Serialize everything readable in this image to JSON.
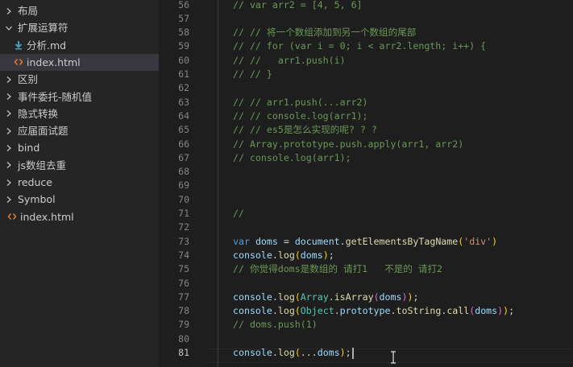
{
  "sidebar": {
    "items": [
      {
        "label": "布局",
        "type": "folder",
        "expanded": false
      },
      {
        "label": "扩展运算符",
        "type": "folder",
        "expanded": true
      },
      {
        "label": "分析.md",
        "type": "markdown",
        "icon": "markdown-download-icon"
      },
      {
        "label": "index.html",
        "type": "html",
        "selected": true
      },
      {
        "label": "区别",
        "type": "folder",
        "expanded": false
      },
      {
        "label": "事件委托-随机值",
        "type": "folder",
        "expanded": false
      },
      {
        "label": "隐式转换",
        "type": "folder",
        "expanded": false
      },
      {
        "label": "应届面试题",
        "type": "folder",
        "expanded": false
      },
      {
        "label": "bind",
        "type": "folder",
        "expanded": false
      },
      {
        "label": "js数组去重",
        "type": "folder",
        "expanded": false
      },
      {
        "label": "reduce",
        "type": "folder",
        "expanded": false
      },
      {
        "label": "Symbol",
        "type": "folder",
        "expanded": false
      },
      {
        "label": "index.html",
        "type": "html"
      }
    ]
  },
  "editor": {
    "active_line": "81",
    "lines": [
      {
        "num": "56",
        "text": "// var arr2 = [4, 5, 6]"
      },
      {
        "num": "57",
        "text": ""
      },
      {
        "num": "58",
        "text": "// // 将一个数组添加到另一个数组的尾部"
      },
      {
        "num": "59",
        "text": "// // for (var i = 0; i < arr2.length; i++) {"
      },
      {
        "num": "60",
        "text": "// //   arr1.push(i)"
      },
      {
        "num": "61",
        "text": "// // }"
      },
      {
        "num": "62",
        "text": ""
      },
      {
        "num": "63",
        "text": "// // arr1.push(...arr2)"
      },
      {
        "num": "64",
        "text": "// // console.log(arr1);"
      },
      {
        "num": "65",
        "text": "// // es5是怎么实现的呢? ? ?"
      },
      {
        "num": "66",
        "text": "// Array.prototype.push.apply(arr1, arr2)"
      },
      {
        "num": "67",
        "text": "// console.log(arr1);"
      },
      {
        "num": "68",
        "text": ""
      },
      {
        "num": "69",
        "text": ""
      },
      {
        "num": "70",
        "text": ""
      },
      {
        "num": "71",
        "text": "//"
      },
      {
        "num": "72",
        "text": ""
      },
      {
        "num": "73",
        "tokens": [
          {
            "t": "var",
            "c": "kw"
          },
          {
            "t": " ",
            "c": "punc"
          },
          {
            "t": "doms",
            "c": "var"
          },
          {
            "t": " = ",
            "c": "punc"
          },
          {
            "t": "document",
            "c": "var"
          },
          {
            "t": ".",
            "c": "punc"
          },
          {
            "t": "getElementsByTagName",
            "c": "fn"
          },
          {
            "t": "(",
            "c": "bracket"
          },
          {
            "t": "'div'",
            "c": "str"
          },
          {
            "t": ")",
            "c": "bracket"
          }
        ]
      },
      {
        "num": "74",
        "tokens": [
          {
            "t": "console",
            "c": "var"
          },
          {
            "t": ".",
            "c": "punc"
          },
          {
            "t": "log",
            "c": "fn"
          },
          {
            "t": "(",
            "c": "bracket"
          },
          {
            "t": "doms",
            "c": "var"
          },
          {
            "t": ")",
            "c": "bracket"
          },
          {
            "t": ";",
            "c": "punc"
          }
        ]
      },
      {
        "num": "75",
        "text": "// 你觉得doms是数组的 请打1   不是的 请打2"
      },
      {
        "num": "76",
        "text": ""
      },
      {
        "num": "77",
        "tokens": [
          {
            "t": "console",
            "c": "var"
          },
          {
            "t": ".",
            "c": "punc"
          },
          {
            "t": "log",
            "c": "fn"
          },
          {
            "t": "(",
            "c": "bracket"
          },
          {
            "t": "Array",
            "c": "cls"
          },
          {
            "t": ".",
            "c": "punc"
          },
          {
            "t": "isArray",
            "c": "fn"
          },
          {
            "t": "(",
            "c": "bracket2"
          },
          {
            "t": "doms",
            "c": "var"
          },
          {
            "t": ")",
            "c": "bracket2"
          },
          {
            "t": ")",
            "c": "bracket"
          },
          {
            "t": ";",
            "c": "punc"
          }
        ]
      },
      {
        "num": "78",
        "tokens": [
          {
            "t": "console",
            "c": "var"
          },
          {
            "t": ".",
            "c": "punc"
          },
          {
            "t": "log",
            "c": "fn"
          },
          {
            "t": "(",
            "c": "bracket"
          },
          {
            "t": "Object",
            "c": "cls"
          },
          {
            "t": ".",
            "c": "punc"
          },
          {
            "t": "prototype",
            "c": "var"
          },
          {
            "t": ".",
            "c": "punc"
          },
          {
            "t": "toString",
            "c": "fn"
          },
          {
            "t": ".",
            "c": "punc"
          },
          {
            "t": "call",
            "c": "fn"
          },
          {
            "t": "(",
            "c": "bracket2"
          },
          {
            "t": "doms",
            "c": "var"
          },
          {
            "t": ")",
            "c": "bracket2"
          },
          {
            "t": ")",
            "c": "bracket"
          },
          {
            "t": ";",
            "c": "punc"
          }
        ]
      },
      {
        "num": "79",
        "text": "// doms.push(1)"
      },
      {
        "num": "80",
        "text": ""
      },
      {
        "num": "81",
        "tokens": [
          {
            "t": "console",
            "c": "var"
          },
          {
            "t": ".",
            "c": "punc"
          },
          {
            "t": "log",
            "c": "fn"
          },
          {
            "t": "(",
            "c": "bracket"
          },
          {
            "t": "...",
            "c": "punc"
          },
          {
            "t": "doms",
            "c": "var"
          },
          {
            "t": ")",
            "c": "bracket"
          },
          {
            "t": ";",
            "c": "punc"
          }
        ]
      }
    ]
  },
  "colors": {
    "sidebar_bg": "#252526",
    "editor_bg": "#1e1e1e",
    "selected_bg": "#37373d",
    "comment": "#6a9955",
    "keyword": "#569cd6",
    "variable": "#9cdcfe",
    "function": "#dcdcaa",
    "class": "#4ec9b0",
    "string": "#ce9178",
    "html_icon": "#e37933",
    "markdown_icon": "#519aba"
  }
}
